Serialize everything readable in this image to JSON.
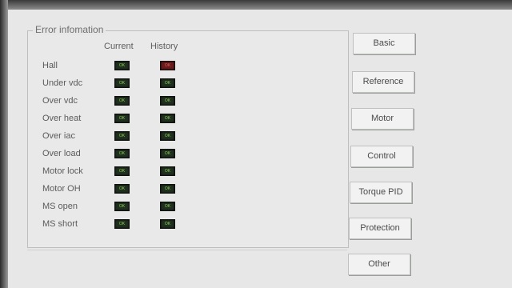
{
  "window": {
    "corner_caption": ""
  },
  "error_panel": {
    "title": "Error infomation",
    "columns": {
      "current": "Current",
      "history": "History"
    },
    "ok_text": "OK",
    "error_text": "OK",
    "rows": [
      {
        "label": "Hall",
        "current": "ok",
        "history": "error"
      },
      {
        "label": "Under vdc",
        "current": "ok",
        "history": "ok"
      },
      {
        "label": "Over vdc",
        "current": "ok",
        "history": "ok"
      },
      {
        "label": "Over heat",
        "current": "ok",
        "history": "ok"
      },
      {
        "label": "Over iac",
        "current": "ok",
        "history": "ok"
      },
      {
        "label": "Over load",
        "current": "ok",
        "history": "ok"
      },
      {
        "label": "Motor lock",
        "current": "ok",
        "history": "ok"
      },
      {
        "label": "Motor OH",
        "current": "ok",
        "history": "ok"
      },
      {
        "label": "MS open",
        "current": "ok",
        "history": "ok"
      },
      {
        "label": "MS short",
        "current": "ok",
        "history": "ok"
      }
    ]
  },
  "nav": {
    "buttons": [
      "Basic",
      "Reference",
      "Motor",
      "Control",
      "Torque PID",
      "Protection",
      "Other"
    ]
  },
  "colors": {
    "ok": "#8bd14a",
    "error": "#b02a2a",
    "background": "#e6e7e6"
  }
}
